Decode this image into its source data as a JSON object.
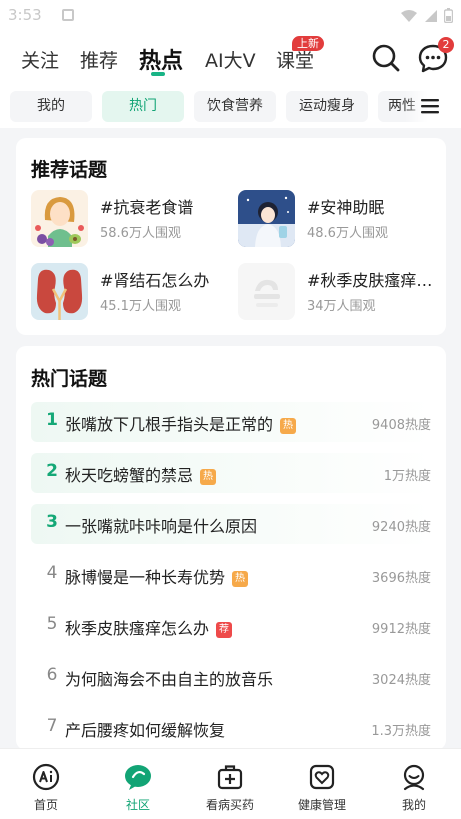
{
  "status_bar": {
    "time": "3:53"
  },
  "header": {
    "tabs": [
      {
        "label": "关注"
      },
      {
        "label": "推荐"
      },
      {
        "label": "热点"
      },
      {
        "label": "AI大V"
      },
      {
        "label": "课堂"
      }
    ],
    "active_tab": "热点",
    "new_badge": "上新",
    "message_count": "2"
  },
  "chips": {
    "items": [
      "我的",
      "热门",
      "饮食营养",
      "运动瘦身",
      "两性"
    ],
    "active": "热门"
  },
  "recommended": {
    "title": "推荐话题",
    "items": [
      {
        "name": "#抗衰老食谱",
        "views": "58.6万人围观"
      },
      {
        "name": "#安神助眠",
        "views": "48.6万人围观"
      },
      {
        "name": "#肾结石怎么办",
        "views": "45.1万人围观"
      },
      {
        "name": "#秋季皮肤瘙痒怎么办",
        "views": "34万人围观"
      }
    ]
  },
  "hot": {
    "title": "热门话题",
    "items": [
      {
        "rank": "1",
        "title": "张嘴放下几根手指头是正常的",
        "tag": "热",
        "heat": "9408热度"
      },
      {
        "rank": "2",
        "title": "秋天吃螃蟹的禁忌",
        "tag": "热",
        "heat": "1万热度"
      },
      {
        "rank": "3",
        "title": "一张嘴就咔咔响是什么原因",
        "tag": "",
        "heat": "9240热度"
      },
      {
        "rank": "4",
        "title": "脉博慢是一种长寿优势",
        "tag": "热",
        "heat": "3696热度"
      },
      {
        "rank": "5",
        "title": "秋季皮肤瘙痒怎么办",
        "tag": "荐",
        "heat": "9912热度"
      },
      {
        "rank": "6",
        "title": "为何脑海会不由自主的放音乐",
        "tag": "",
        "heat": "3024热度"
      },
      {
        "rank": "7",
        "title": "产后腰疼如何缓解恢复",
        "tag": "",
        "heat": "1.3万热度"
      }
    ]
  },
  "bottom_nav": {
    "items": [
      {
        "label": "首页",
        "icon": "ai-home-icon"
      },
      {
        "label": "社区",
        "icon": "community-icon"
      },
      {
        "label": "看病买药",
        "icon": "medicine-box-icon"
      },
      {
        "label": "健康管理",
        "icon": "health-heart-icon"
      },
      {
        "label": "我的",
        "icon": "profile-icon"
      }
    ],
    "active": "社区"
  },
  "colors": {
    "accent": "#12a475",
    "badge": "#e23c3c",
    "hot_tag": "#f6a94a",
    "rec_tag": "#ee4a4a"
  }
}
